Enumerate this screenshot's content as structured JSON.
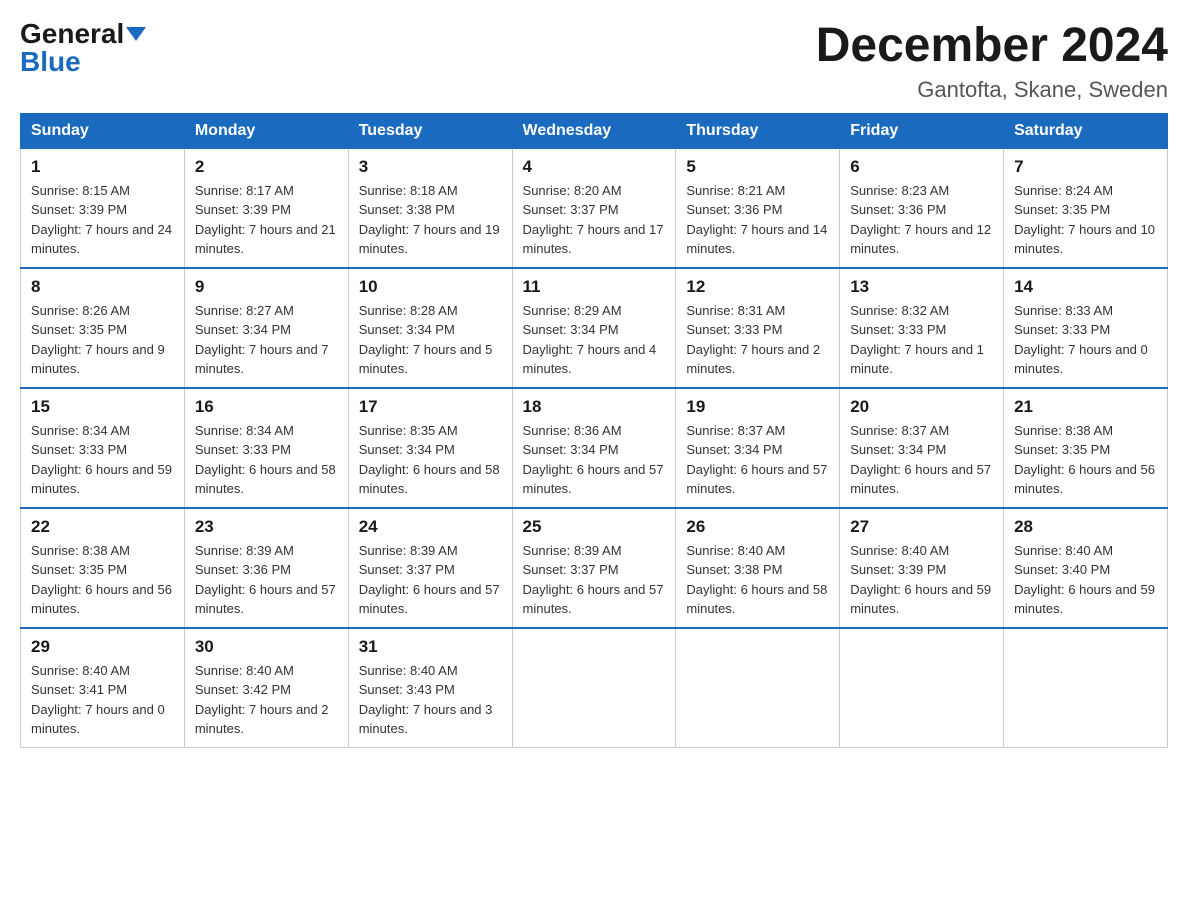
{
  "logo": {
    "general": "General",
    "blue": "Blue"
  },
  "title": "December 2024",
  "subtitle": "Gantofta, Skane, Sweden",
  "days_of_week": [
    "Sunday",
    "Monday",
    "Tuesday",
    "Wednesday",
    "Thursday",
    "Friday",
    "Saturday"
  ],
  "weeks": [
    [
      {
        "day": "1",
        "sunrise": "Sunrise: 8:15 AM",
        "sunset": "Sunset: 3:39 PM",
        "daylight": "Daylight: 7 hours and 24 minutes."
      },
      {
        "day": "2",
        "sunrise": "Sunrise: 8:17 AM",
        "sunset": "Sunset: 3:39 PM",
        "daylight": "Daylight: 7 hours and 21 minutes."
      },
      {
        "day": "3",
        "sunrise": "Sunrise: 8:18 AM",
        "sunset": "Sunset: 3:38 PM",
        "daylight": "Daylight: 7 hours and 19 minutes."
      },
      {
        "day": "4",
        "sunrise": "Sunrise: 8:20 AM",
        "sunset": "Sunset: 3:37 PM",
        "daylight": "Daylight: 7 hours and 17 minutes."
      },
      {
        "day": "5",
        "sunrise": "Sunrise: 8:21 AM",
        "sunset": "Sunset: 3:36 PM",
        "daylight": "Daylight: 7 hours and 14 minutes."
      },
      {
        "day": "6",
        "sunrise": "Sunrise: 8:23 AM",
        "sunset": "Sunset: 3:36 PM",
        "daylight": "Daylight: 7 hours and 12 minutes."
      },
      {
        "day": "7",
        "sunrise": "Sunrise: 8:24 AM",
        "sunset": "Sunset: 3:35 PM",
        "daylight": "Daylight: 7 hours and 10 minutes."
      }
    ],
    [
      {
        "day": "8",
        "sunrise": "Sunrise: 8:26 AM",
        "sunset": "Sunset: 3:35 PM",
        "daylight": "Daylight: 7 hours and 9 minutes."
      },
      {
        "day": "9",
        "sunrise": "Sunrise: 8:27 AM",
        "sunset": "Sunset: 3:34 PM",
        "daylight": "Daylight: 7 hours and 7 minutes."
      },
      {
        "day": "10",
        "sunrise": "Sunrise: 8:28 AM",
        "sunset": "Sunset: 3:34 PM",
        "daylight": "Daylight: 7 hours and 5 minutes."
      },
      {
        "day": "11",
        "sunrise": "Sunrise: 8:29 AM",
        "sunset": "Sunset: 3:34 PM",
        "daylight": "Daylight: 7 hours and 4 minutes."
      },
      {
        "day": "12",
        "sunrise": "Sunrise: 8:31 AM",
        "sunset": "Sunset: 3:33 PM",
        "daylight": "Daylight: 7 hours and 2 minutes."
      },
      {
        "day": "13",
        "sunrise": "Sunrise: 8:32 AM",
        "sunset": "Sunset: 3:33 PM",
        "daylight": "Daylight: 7 hours and 1 minute."
      },
      {
        "day": "14",
        "sunrise": "Sunrise: 8:33 AM",
        "sunset": "Sunset: 3:33 PM",
        "daylight": "Daylight: 7 hours and 0 minutes."
      }
    ],
    [
      {
        "day": "15",
        "sunrise": "Sunrise: 8:34 AM",
        "sunset": "Sunset: 3:33 PM",
        "daylight": "Daylight: 6 hours and 59 minutes."
      },
      {
        "day": "16",
        "sunrise": "Sunrise: 8:34 AM",
        "sunset": "Sunset: 3:33 PM",
        "daylight": "Daylight: 6 hours and 58 minutes."
      },
      {
        "day": "17",
        "sunrise": "Sunrise: 8:35 AM",
        "sunset": "Sunset: 3:34 PM",
        "daylight": "Daylight: 6 hours and 58 minutes."
      },
      {
        "day": "18",
        "sunrise": "Sunrise: 8:36 AM",
        "sunset": "Sunset: 3:34 PM",
        "daylight": "Daylight: 6 hours and 57 minutes."
      },
      {
        "day": "19",
        "sunrise": "Sunrise: 8:37 AM",
        "sunset": "Sunset: 3:34 PM",
        "daylight": "Daylight: 6 hours and 57 minutes."
      },
      {
        "day": "20",
        "sunrise": "Sunrise: 8:37 AM",
        "sunset": "Sunset: 3:34 PM",
        "daylight": "Daylight: 6 hours and 57 minutes."
      },
      {
        "day": "21",
        "sunrise": "Sunrise: 8:38 AM",
        "sunset": "Sunset: 3:35 PM",
        "daylight": "Daylight: 6 hours and 56 minutes."
      }
    ],
    [
      {
        "day": "22",
        "sunrise": "Sunrise: 8:38 AM",
        "sunset": "Sunset: 3:35 PM",
        "daylight": "Daylight: 6 hours and 56 minutes."
      },
      {
        "day": "23",
        "sunrise": "Sunrise: 8:39 AM",
        "sunset": "Sunset: 3:36 PM",
        "daylight": "Daylight: 6 hours and 57 minutes."
      },
      {
        "day": "24",
        "sunrise": "Sunrise: 8:39 AM",
        "sunset": "Sunset: 3:37 PM",
        "daylight": "Daylight: 6 hours and 57 minutes."
      },
      {
        "day": "25",
        "sunrise": "Sunrise: 8:39 AM",
        "sunset": "Sunset: 3:37 PM",
        "daylight": "Daylight: 6 hours and 57 minutes."
      },
      {
        "day": "26",
        "sunrise": "Sunrise: 8:40 AM",
        "sunset": "Sunset: 3:38 PM",
        "daylight": "Daylight: 6 hours and 58 minutes."
      },
      {
        "day": "27",
        "sunrise": "Sunrise: 8:40 AM",
        "sunset": "Sunset: 3:39 PM",
        "daylight": "Daylight: 6 hours and 59 minutes."
      },
      {
        "day": "28",
        "sunrise": "Sunrise: 8:40 AM",
        "sunset": "Sunset: 3:40 PM",
        "daylight": "Daylight: 6 hours and 59 minutes."
      }
    ],
    [
      {
        "day": "29",
        "sunrise": "Sunrise: 8:40 AM",
        "sunset": "Sunset: 3:41 PM",
        "daylight": "Daylight: 7 hours and 0 minutes."
      },
      {
        "day": "30",
        "sunrise": "Sunrise: 8:40 AM",
        "sunset": "Sunset: 3:42 PM",
        "daylight": "Daylight: 7 hours and 2 minutes."
      },
      {
        "day": "31",
        "sunrise": "Sunrise: 8:40 AM",
        "sunset": "Sunset: 3:43 PM",
        "daylight": "Daylight: 7 hours and 3 minutes."
      },
      null,
      null,
      null,
      null
    ]
  ]
}
